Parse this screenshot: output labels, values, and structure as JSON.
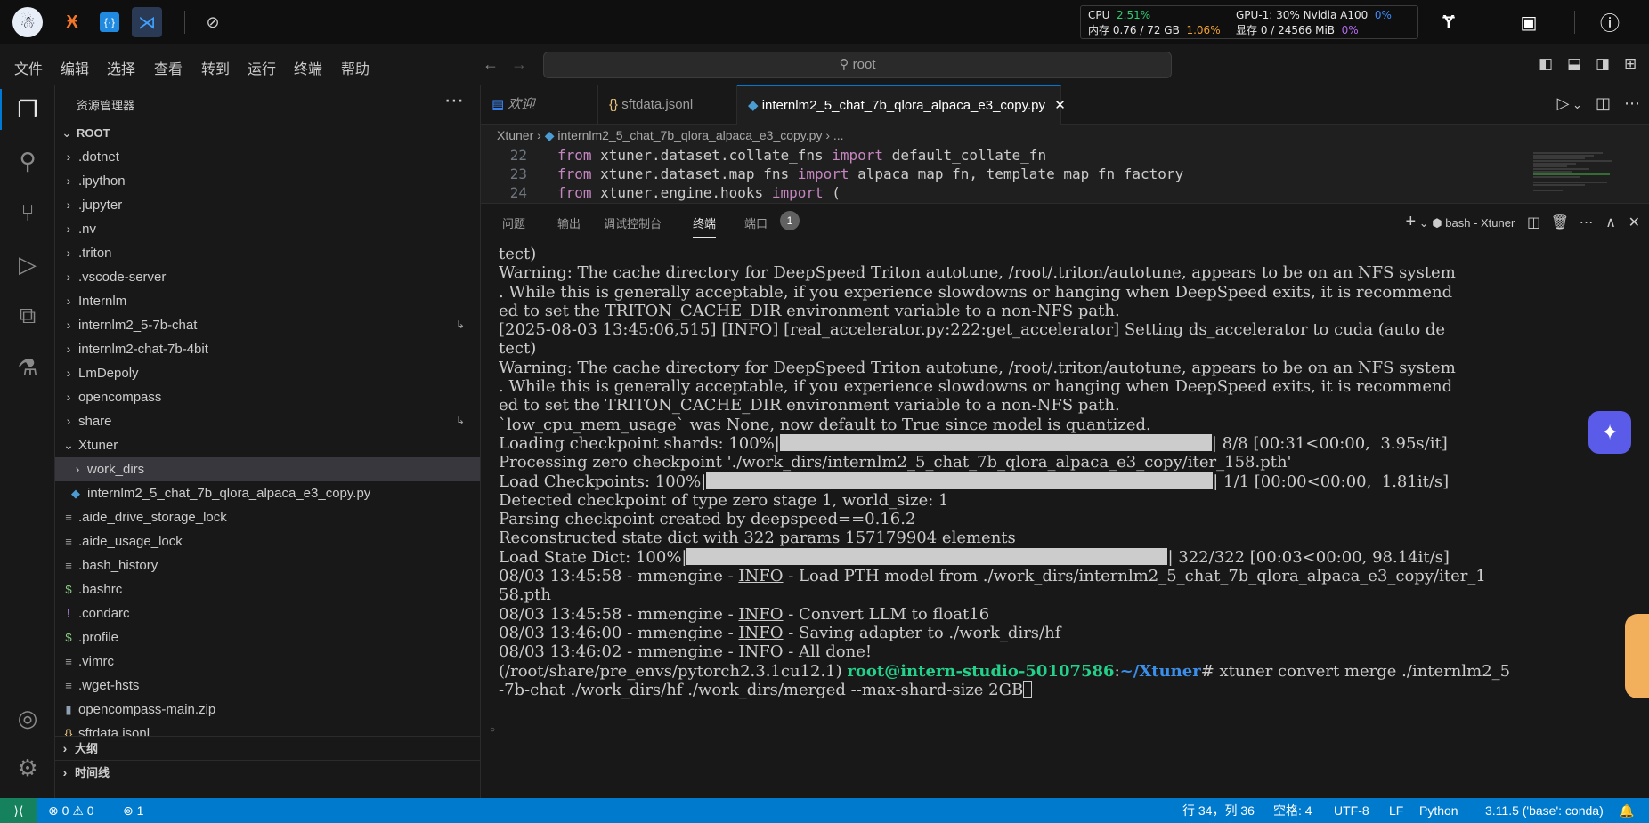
{
  "topbar": {
    "stats": {
      "cpu_label": "CPU",
      "cpu_value": "2.51%",
      "mem_label": "内存 0.76 / 72 GB",
      "mem_value": "1.06%",
      "gpu_label": "GPU-1: 30% Nvidia A100",
      "gpu_value": "0%",
      "vram_label": "显存 0 / 24566 MiB",
      "vram_value": "0%"
    }
  },
  "menu": [
    "文件",
    "编辑",
    "选择",
    "查看",
    "转到",
    "运行",
    "终端",
    "帮助"
  ],
  "command_center": {
    "text": "root"
  },
  "sidebar": {
    "title": "资源管理器",
    "root": "ROOT",
    "items": [
      ".dotnet",
      ".ipython",
      ".jupyter",
      ".nv",
      ".triton",
      ".vscode-server",
      "Internlm",
      "internlm2_5-7b-chat",
      "internlm2-chat-7b-4bit",
      "LmDepoly",
      "opencompass",
      "share",
      "Xtuner",
      "work_dirs",
      "internlm2_5_chat_7b_qlora_alpaca_e3_copy.py",
      ".aide_drive_storage_lock",
      ".aide_usage_lock",
      ".bash_history",
      ".bashrc",
      ".condarc",
      ".profile",
      ".vimrc",
      ".wget-hsts",
      "opencompass-main.zip",
      "sftdata.jsonl"
    ],
    "outline": "大纲",
    "timeline": "时间线"
  },
  "tabs": [
    "欢迎",
    "sftdata.jsonl",
    "internlm2_5_chat_7b_qlora_alpaca_e3_copy.py"
  ],
  "breadcrumb": {
    "folder": "Xtuner",
    "sep1": "›",
    "file": "internlm2_5_chat_7b_qlora_alpaca_e3_copy.py",
    "sep2": "› ..."
  },
  "code": [
    {
      "ln": "22",
      "kw1": "from",
      "mid": " xtuner.dataset.collate_fns ",
      "kw2": "import",
      "rest": " default_collate_fn"
    },
    {
      "ln": "23",
      "kw1": "from",
      "mid": " xtuner.dataset.map_fns ",
      "kw2": "import",
      "rest": " alpaca_map_fn, template_map_fn_factory"
    },
    {
      "ln": "24",
      "kw1": "from",
      "mid": " xtuner.engine.hooks ",
      "kw2": "import",
      "rest": " ("
    }
  ],
  "panel": {
    "tabs": [
      "问题",
      "输出",
      "调试控制台",
      "终端",
      "端口"
    ],
    "ports_count": "1",
    "terminal_name": "bash - Xtuner"
  },
  "terminal": {
    "l1": "tect)",
    "l2": "Warning: The cache directory for DeepSpeed Triton autotune, /root/.triton/autotune, appears to be on an NFS system",
    "l3": ". While this is generally acceptable, if you experience slowdowns or hanging when DeepSpeed exits, it is recommend",
    "l4": "ed to set the TRITON_CACHE_DIR environment variable to a non-NFS path.",
    "l5": "[2025-08-03 13:45:06,515] [INFO] [real_accelerator.py:222:get_accelerator] Setting ds_accelerator to cuda (auto de",
    "l6": "tect)",
    "l7": "Warning: The cache directory for DeepSpeed Triton autotune, /root/.triton/autotune, appears to be on an NFS system",
    "l8": ". While this is generally acceptable, if you experience slowdowns or hanging when DeepSpeed exits, it is recommend",
    "l9": "ed to set the TRITON_CACHE_DIR environment variable to a non-NFS path.",
    "l10": "`low_cpu_mem_usage` was None, now default to True since model is quantized.",
    "p1_a": "Loading checkpoint shards: 100%|",
    "p1_b": "| 8/8 [00:31<00:00,  3.95s/it]",
    "l12": "Processing zero checkpoint './work_dirs/internlm2_5_chat_7b_qlora_alpaca_e3_copy/iter_158.pth'",
    "p2_a": "Load Checkpoints: 100%|",
    "p2_b": "| 1/1 [00:00<00:00,  1.81it/s]",
    "l14": "Detected checkpoint of type zero stage 1, world_size: 1",
    "l15": "Parsing checkpoint created by deepspeed==0.16.2",
    "l16": "Reconstructed state dict with 322 params 157179904 elements",
    "p3_a": "Load State Dict: 100%|",
    "p3_b": "| 322/322 [00:03<00:00, 98.14it/s]",
    "m1_a": "08/03 13:45:58 - mmengine - ",
    "m1_b": "INFO",
    "m1_c": " - Load PTH model from ./work_dirs/internlm2_5_chat_7b_qlora_alpaca_e3_copy/iter_1",
    "l19": "58.pth",
    "m2_a": "08/03 13:45:58 - mmengine - ",
    "m2_b": "INFO",
    "m2_c": " - Convert LLM to float16",
    "m3_a": "08/03 13:46:00 - mmengine - ",
    "m3_b": "INFO",
    "m3_c": " - Saving adapter to ./work_dirs/hf",
    "m4_a": "08/03 13:46:02 - mmengine - ",
    "m4_b": "INFO",
    "m4_c": " - All done!",
    "pr_env": "(/root/share/pre_envs/pytorch2.3.1cu12.1) ",
    "pr_user": "root@intern-studio-50107586",
    "pr_colon": ":",
    "pr_path": "~/Xtuner",
    "pr_cmd": "# xtuner convert merge ./internlm2_5",
    "l24": "-7b-chat ./work_dirs/hf ./work_dirs/merged --max-shard-size 2GB"
  },
  "status": {
    "errors": "0",
    "warnings": "0",
    "ports": "1",
    "position": "行 34，列 36",
    "spaces": "空格: 4",
    "encoding": "UTF-8",
    "eol": "LF",
    "language": "Python",
    "interpreter": "3.11.5 ('base': conda)"
  },
  "colors": {
    "accent": "#007acc",
    "terminal_green": "#23d18b",
    "terminal_blue": "#3b8eea"
  }
}
